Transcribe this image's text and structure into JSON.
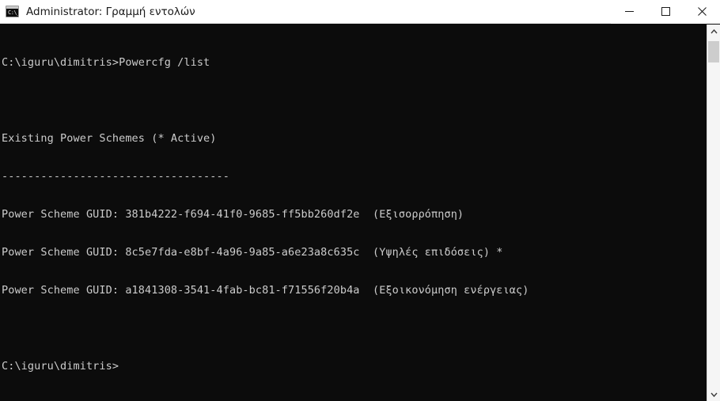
{
  "window": {
    "title": "Administrator: Γραμμή εντολών",
    "icon": "cmd-console-icon",
    "icon_glyph": "C:\\_",
    "background_color": "#0c0c0c",
    "titlebar_color": "#ffffff",
    "text_color": "#cccccc"
  },
  "title_buttons": {
    "minimize_label": "Ελαχιστοποίηση",
    "maximize_label": "Μεγιστοποίηση",
    "close_label": "Κλείσιμο"
  },
  "console": {
    "prompt_path": "C:\\iguru\\dimitris>",
    "command": "Powercfg /list",
    "lines": [
      "C:\\iguru\\dimitris>Powercfg /list",
      "",
      "Existing Power Schemes (* Active)",
      "-----------------------------------",
      "Power Scheme GUID: 381b4222-f694-41f0-9685-ff5bb260df2e  (Εξισορρόπηση)",
      "Power Scheme GUID: 8c5e7fda-e8bf-4a96-9a85-a6e23a8c635c  (Υψηλές επιδόσεις) *",
      "Power Scheme GUID: a1841308-3541-4fab-bc81-f71556f20b4a  (Εξοικονόμηση ενέργειας)",
      "",
      "C:\\iguru\\dimitris>"
    ],
    "header": "Existing Power Schemes (* Active)",
    "separator": "-----------------------------------",
    "schemes": [
      {
        "label": "Power Scheme GUID:",
        "guid": "381b4222-f694-41f0-9685-ff5bb260df2e",
        "name": "(Εξισορρόπηση)",
        "active": false
      },
      {
        "label": "Power Scheme GUID:",
        "guid": "8c5e7fda-e8bf-4a96-9a85-a6e23a8c635c",
        "name": "(Υψηλές επιδόσεις)",
        "active": true,
        "active_marker": "*"
      },
      {
        "label": "Power Scheme GUID:",
        "guid": "a1841308-3541-4fab-bc81-f71556f20b4a",
        "name": "(Εξοικονόμηση ενέργειας)",
        "active": false
      }
    ]
  },
  "scrollbar": {
    "up_arrow": "chevron-up-icon",
    "down_arrow": "chevron-down-icon",
    "thumb_color": "#cdcdcd"
  }
}
